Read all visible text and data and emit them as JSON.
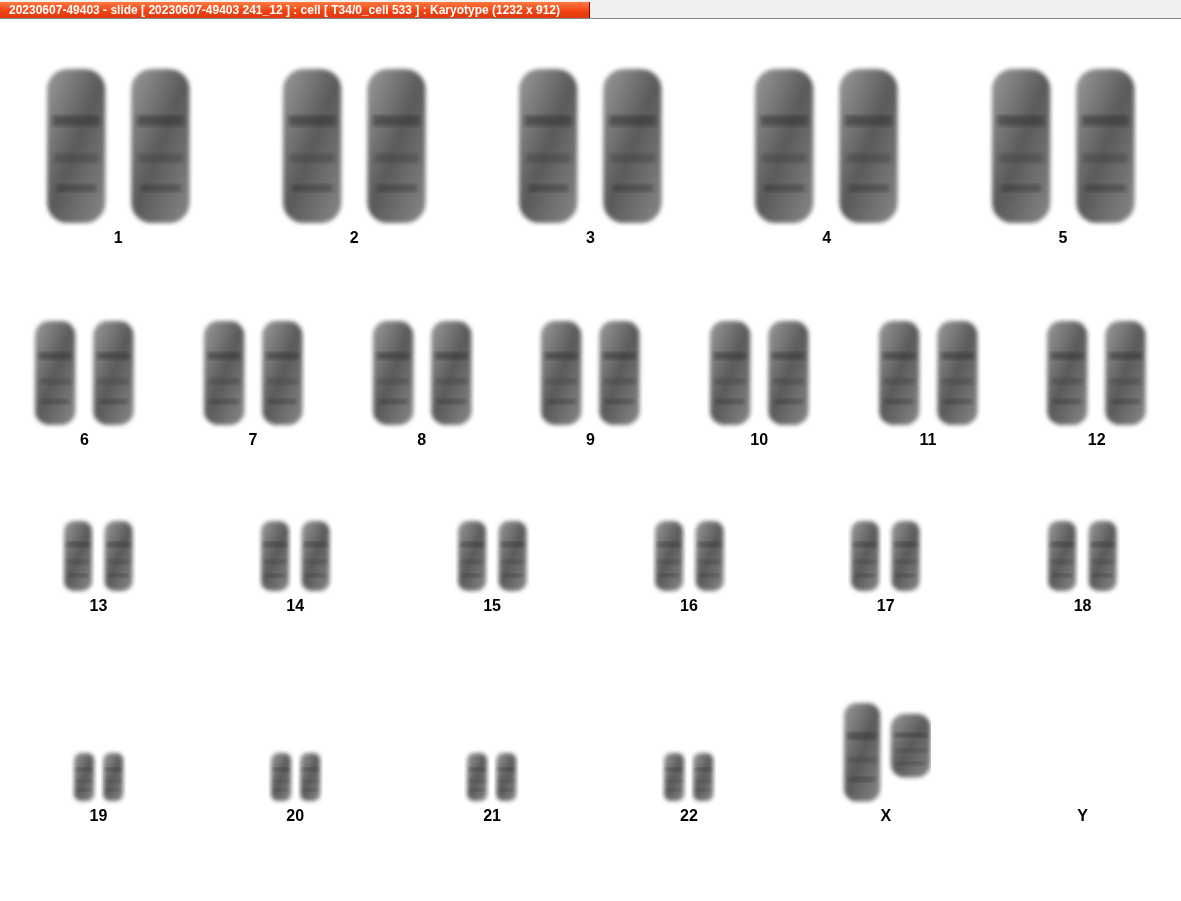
{
  "window": {
    "title": "20230607-49403 - slide [ 20230607-49403 241_12 ] : cell [ T34/0_cell 533 ] : Karyotype  (1232 x 912)"
  },
  "karyotype": {
    "rows": [
      {
        "items": [
          {
            "label": "1",
            "kind": "pair"
          },
          {
            "label": "2",
            "kind": "pair"
          },
          {
            "label": "3",
            "kind": "pair"
          },
          {
            "label": "4",
            "kind": "pair"
          },
          {
            "label": "5",
            "kind": "pair"
          }
        ]
      },
      {
        "items": [
          {
            "label": "6",
            "kind": "pair"
          },
          {
            "label": "7",
            "kind": "pair"
          },
          {
            "label": "8",
            "kind": "pair"
          },
          {
            "label": "9",
            "kind": "pair"
          },
          {
            "label": "10",
            "kind": "pair"
          },
          {
            "label": "11",
            "kind": "pair"
          },
          {
            "label": "12",
            "kind": "pair"
          }
        ]
      },
      {
        "items": [
          {
            "label": "13",
            "kind": "pair"
          },
          {
            "label": "14",
            "kind": "pair"
          },
          {
            "label": "15",
            "kind": "pair"
          },
          {
            "label": "16",
            "kind": "pair"
          },
          {
            "label": "17",
            "kind": "pair"
          },
          {
            "label": "18",
            "kind": "pair"
          }
        ]
      },
      {
        "items": [
          {
            "label": "19",
            "kind": "pair"
          },
          {
            "label": "20",
            "kind": "pair"
          },
          {
            "label": "21",
            "kind": "pair"
          },
          {
            "label": "22",
            "kind": "pair"
          },
          {
            "label": "X",
            "kind": "large-pair"
          },
          {
            "label": "Y",
            "kind": "none"
          }
        ]
      }
    ]
  }
}
